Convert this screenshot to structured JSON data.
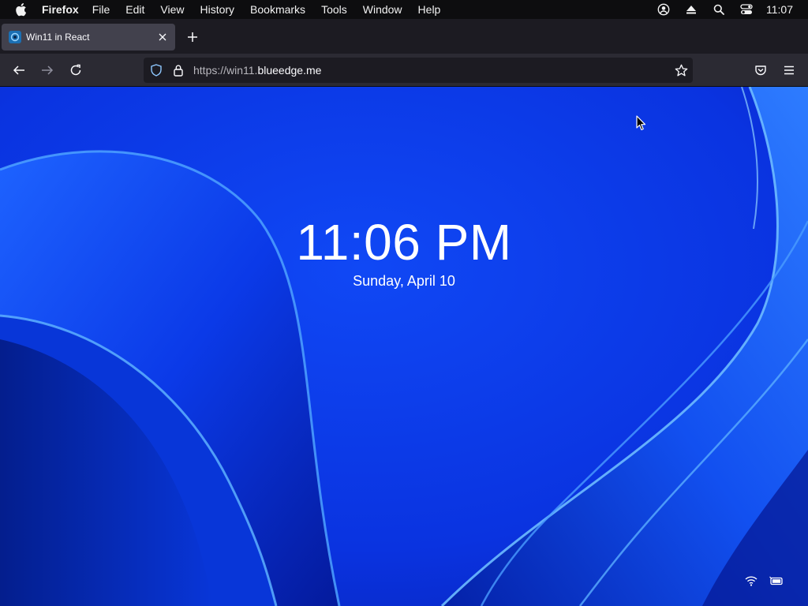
{
  "menubar": {
    "app_name": "Firefox",
    "items": [
      "File",
      "Edit",
      "View",
      "History",
      "Bookmarks",
      "Tools",
      "Window",
      "Help"
    ],
    "clock": "11:07"
  },
  "tab": {
    "title": "Win11 in React"
  },
  "urlbar": {
    "url_prefix": "https://win11.",
    "url_domain": "blueedge.me"
  },
  "lockscreen": {
    "time": "11:06 PM",
    "date": "Sunday, April 10"
  },
  "icons": {
    "menubar": [
      "apple-icon",
      "user-account-icon",
      "eject-icon",
      "spotlight-search-icon",
      "control-center-icon"
    ],
    "toolbar": [
      "back-icon",
      "forward-icon",
      "reload-icon",
      "shield-icon",
      "lock-icon",
      "bookmark-star-icon",
      "pocket-icon",
      "hamburger-menu-icon"
    ],
    "tray": [
      "wifi-icon",
      "battery-icon"
    ]
  },
  "colors": {
    "wallpaper_blue": "#0a2fe0",
    "menubar_bg": "#0d0d0f",
    "tabstrip_bg": "#1c1b22",
    "toolbar_bg": "#2b2a33"
  }
}
